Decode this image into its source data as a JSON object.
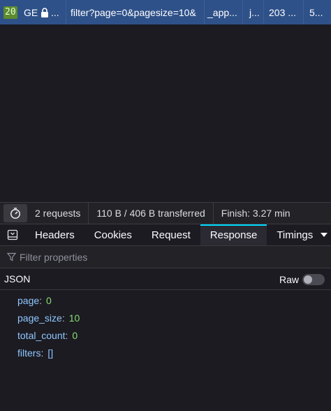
{
  "request_row": {
    "status": "20",
    "method": "GE",
    "lock_icon": "lock-icon",
    "domain": "...",
    "file": "filter?page=0&pagesize=10&",
    "initiator": "_app...",
    "type": "j...",
    "transferred": "203 ...",
    "size": "5..."
  },
  "summary": {
    "timer_icon": "stopwatch-icon",
    "requests": "2 requests",
    "transferred": "110 B / 406 B transferred",
    "finish": "Finish: 3.27 min"
  },
  "tabs": {
    "toggle_icon": "panel-toggle-icon",
    "items": [
      "Headers",
      "Cookies",
      "Request",
      "Response",
      "Timings"
    ],
    "active": "Response"
  },
  "filter": {
    "icon": "filter-icon",
    "placeholder": "Filter properties"
  },
  "json_header": {
    "title": "JSON",
    "raw_label": "Raw",
    "raw_enabled": false
  },
  "json_tree": [
    {
      "key": "page",
      "value": "0",
      "type": "number"
    },
    {
      "key": "page_size",
      "value": "10",
      "type": "number"
    },
    {
      "key": "total_count",
      "value": "0",
      "type": "number"
    },
    {
      "key": "filters",
      "value": "[]",
      "type": "array"
    }
  ],
  "colors": {
    "selected_row": "#2f5189",
    "active_tab_accent": "#00ddff",
    "json_key": "#8fc7ff",
    "json_number": "#86de74"
  }
}
